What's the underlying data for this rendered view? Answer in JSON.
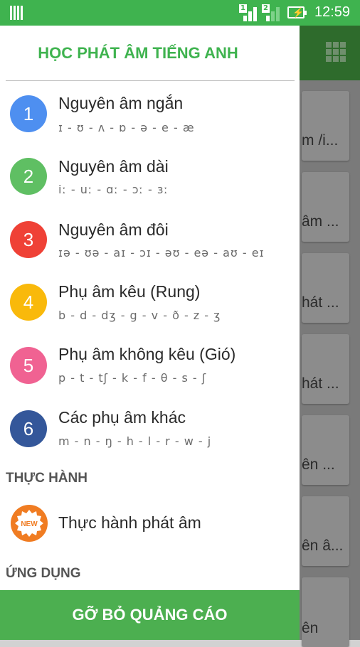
{
  "status_bar": {
    "time": "12:59",
    "sim1_label": "1",
    "sim2_label": "2"
  },
  "background_cards": [
    "m /i...",
    "âm ...",
    "hát ...",
    "hát ...",
    "ên ...",
    "ên â...",
    "ên"
  ],
  "drawer": {
    "title": "HỌC PHÁT ÂM TIẾNG ANH",
    "items": [
      {
        "number": "1",
        "title": "Nguyên âm ngắn",
        "subtitle": "ɪ - ʊ - ʌ - ɒ - ə - e - æ",
        "color": "#4e8ff0"
      },
      {
        "number": "2",
        "title": "Nguyên âm dài",
        "subtitle": "iː - uː - ɑː - ɔː - ɜː",
        "color": "#5fbf63"
      },
      {
        "number": "3",
        "title": "Nguyên âm đôi",
        "subtitle": "ɪə - ʊə - aɪ - ɔɪ - əʊ - eə - aʊ - eɪ",
        "color": "#ef4136"
      },
      {
        "number": "4",
        "title": "Phụ âm kêu (Rung)",
        "subtitle": "b - d - dʒ - g - v - ð - z - ʒ",
        "color": "#f9b90b"
      },
      {
        "number": "5",
        "title": "Phụ âm không kêu (Gió)",
        "subtitle": "p - t - tʃ - k - f - θ - s - ʃ",
        "color": "#f06292"
      },
      {
        "number": "6",
        "title": "Các phụ âm khác",
        "subtitle": "m - n - ŋ - h - l - r - w - j",
        "color": "#34579a"
      }
    ],
    "section_practice": "THỰC HÀNH",
    "practice_item": {
      "badge": "NEW",
      "title": "Thực hành phát âm"
    },
    "section_apps": "ỨNG DỤNG",
    "remove_ads": "GỠ BỎ QUẢNG CÁO"
  }
}
